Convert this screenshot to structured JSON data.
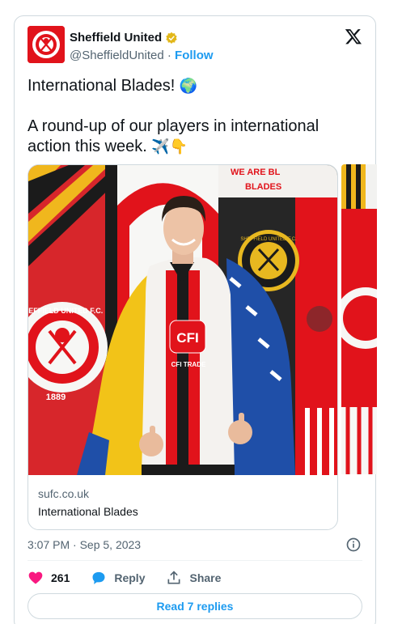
{
  "author": {
    "name": "Sheffield United",
    "handle": "@SheffieldUnited",
    "separator": " · ",
    "follow_label": "Follow",
    "avatar_icon": "sheffield-united-crest-icon",
    "verified_icon": "gold-verified-badge-icon"
  },
  "tweet": {
    "line1_text": "International Blades! ",
    "line1_emoji": "🌍",
    "line2_text": "A round-up of our players in international action this week. ",
    "line2_emoji": "✈️👇"
  },
  "media": {
    "link_domain": "sufc.co.uk",
    "link_title": "International Blades",
    "photo_badge": "CFI",
    "photo_sponsor": "CFI TRADE",
    "crest_right_text": "SHEFFIELD UNITED F.C.",
    "crest_right_year": "1889",
    "crest_left_text": "SHEFFIELD UNITED F.C.",
    "crest_left_year": "1889",
    "wall_text_1": "WE ARE BL",
    "wall_text_2": "BLADES"
  },
  "timestamp": "3:07 PM · Sep 5, 2023",
  "actions": {
    "like_count": "261",
    "reply_label": "Reply",
    "share_label": "Share"
  },
  "read_replies_label": "Read 7 replies",
  "colors": {
    "accent": "#1d9bf0",
    "like": "#f91880",
    "club_red": "#e1131b",
    "verified_gold": "#e2b719"
  }
}
